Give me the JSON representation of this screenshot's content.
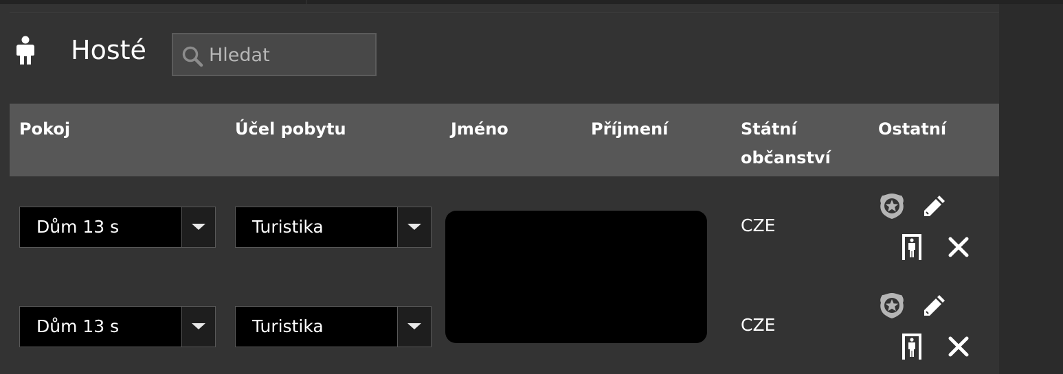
{
  "header": {
    "title": "Hosté",
    "search_placeholder": "Hledat",
    "search_value": ""
  },
  "table": {
    "columns": [
      "Pokoj",
      "Účel pobytu",
      "Jméno",
      "Příjmení",
      "Státní občanství",
      "Ostatní"
    ],
    "rows": [
      {
        "room": "Dům 13 s",
        "purpose": "Turistika",
        "first_name": "",
        "last_name": "",
        "nationality": "CZE",
        "actions": [
          "police-badge-icon",
          "pencil-icon",
          "door-icon",
          "close-icon"
        ]
      },
      {
        "room": "Dům 13 s",
        "purpose": "Turistika",
        "first_name": "",
        "last_name": "",
        "nationality": "CZE",
        "actions": [
          "police-badge-icon",
          "pencil-icon",
          "door-icon",
          "close-icon"
        ]
      }
    ]
  },
  "colors": {
    "background": "#333333",
    "header_row": "#575757",
    "select_bg": "#000000",
    "icon_muted": "#b5b5b5",
    "text": "#ffffff"
  }
}
